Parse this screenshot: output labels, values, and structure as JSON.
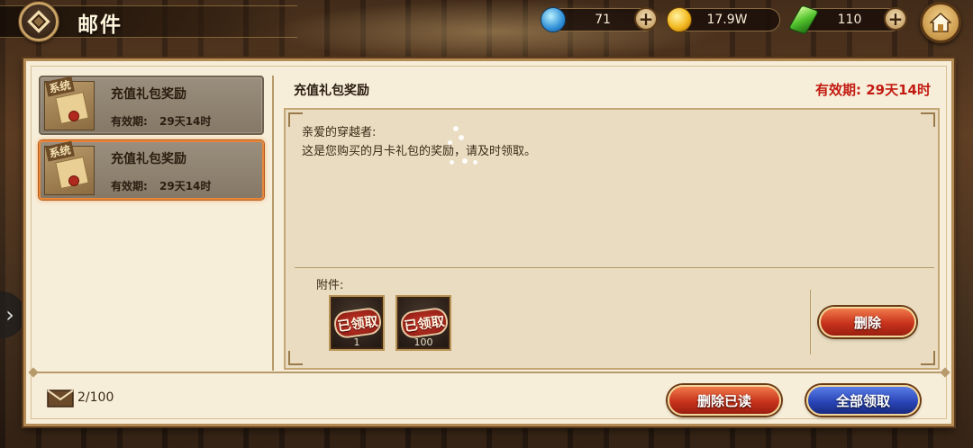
{
  "header": {
    "title": "邮件",
    "resources": [
      {
        "icon": "shell-icon",
        "value": "71"
      },
      {
        "icon": "gold-coin-icon",
        "value": "17.9W"
      },
      {
        "icon": "green-gem-icon",
        "value": "110"
      }
    ]
  },
  "mail_list": {
    "items": [
      {
        "tag": "系统",
        "title": "充值礼包奖励",
        "expiry_label": "有效期:",
        "expiry_value": "29天14时",
        "selected": false
      },
      {
        "tag": "系统",
        "title": "充值礼包奖励",
        "expiry_label": "有效期:",
        "expiry_value": "29天14时",
        "selected": true
      }
    ]
  },
  "detail": {
    "title": "充值礼包奖励",
    "expiry": "有效期: 29天14时",
    "greeting": "亲爱的穿越者:",
    "body": "这是您购买的月卡礼包的奖励，请及时领取。",
    "attachments_label": "附件:",
    "attachments": [
      {
        "stamp": "已领取",
        "count": "1"
      },
      {
        "stamp": "已领取",
        "count": "100"
      }
    ],
    "delete_label": "删除"
  },
  "footer": {
    "mail_count": "2/100",
    "delete_read_label": "删除已读",
    "claim_all_label": "全部领取"
  },
  "colors": {
    "expiry_red": "#c21b12",
    "selected_border": "#e8873a",
    "panel_bg": "#f7eed9"
  }
}
